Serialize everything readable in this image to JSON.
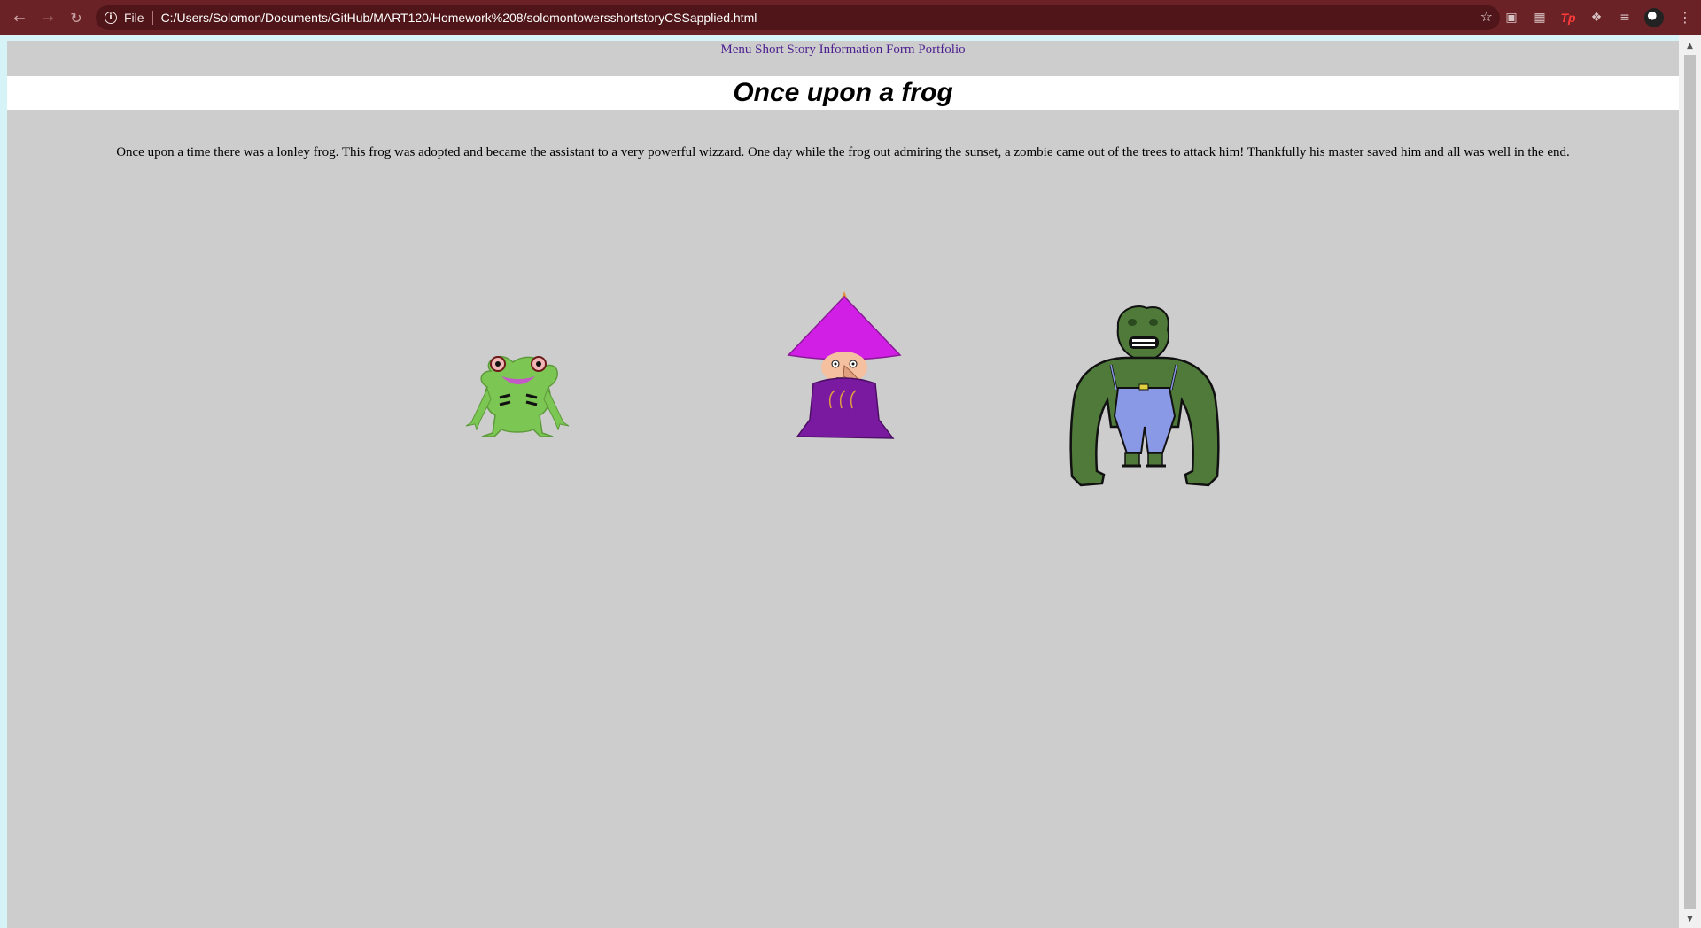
{
  "browser": {
    "file_label": "File",
    "url": "C:/Users/Solomon/Documents/GitHub/MART120/Homework%208/solomontowersshortstoryCSSapplied.html",
    "icons": [
      "back-icon",
      "forward-icon",
      "reload-icon",
      "info-icon",
      "star-icon",
      "extension-icon",
      "puzzle-icon",
      "reading-list-icon",
      "profile-avatar",
      "menu-icon"
    ],
    "ext_tp_label": "Tp"
  },
  "page": {
    "menu": [
      "Menu",
      "Short Story",
      "Information Form",
      "Portfolio"
    ],
    "title": "Once upon a frog",
    "story": "Once upon a time there was a lonley frog. This frog was adopted and became the assistant to a very powerful wizzard. One day while the frog out admiring the sunset, a zombie came out of the trees to attack him! Thankfully his master saved him and all was well in the end."
  },
  "colors": {
    "chrome": "#6b2226",
    "page_bg": "#cdcdcd",
    "link": "#4b1f8f"
  }
}
